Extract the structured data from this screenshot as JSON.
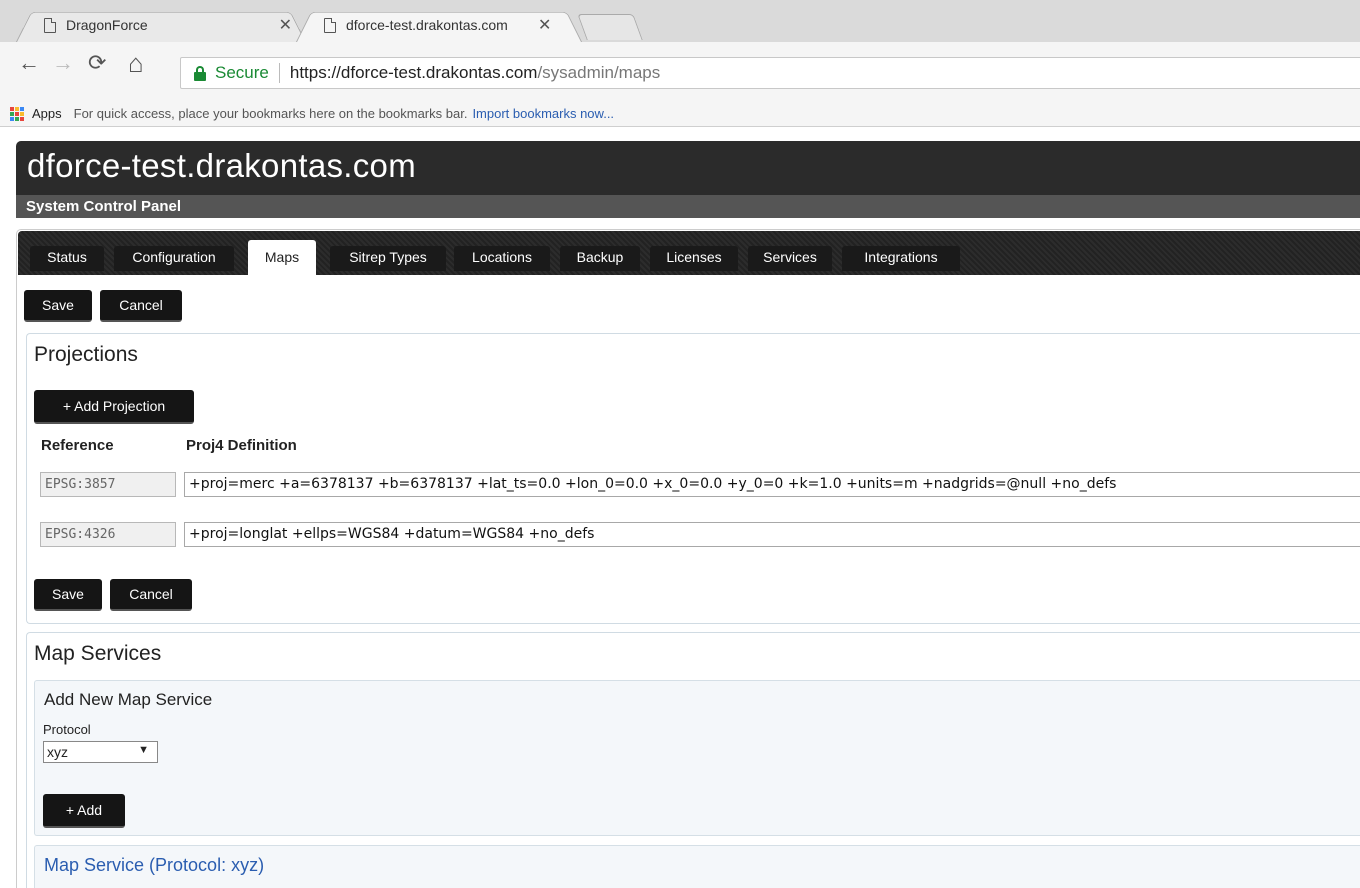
{
  "browser": {
    "tabs": [
      {
        "title": "DragonForce",
        "active": false
      },
      {
        "title": "dforce-test.drakontas.com",
        "active": true
      }
    ],
    "close_glyph": "✕",
    "nav": {
      "back": "←",
      "forward": "→",
      "reload": "⟳",
      "home": "⌂"
    },
    "security_label": "Secure",
    "url_host": "https://dforce-test.drakontas.com",
    "url_path": "/sysadmin/maps",
    "bookmarks": {
      "apps_label": "Apps",
      "hint": "For quick access, place your bookmarks here on the bookmarks bar.",
      "import_link": "Import bookmarks now..."
    },
    "apps_colors": [
      "#e8453c",
      "#f9bb2d",
      "#3a88f4",
      "#34a853",
      "#e8453c",
      "#f9bb2d",
      "#3a88f4",
      "#34a853",
      "#e8453c"
    ]
  },
  "header": {
    "site_title": "dforce-test.drakontas.com",
    "subtitle": "System Control Panel"
  },
  "nav_tabs": [
    "Status",
    "Configuration",
    "Maps",
    "Sitrep Types",
    "Locations",
    "Backup",
    "Licenses",
    "Services",
    "Integrations"
  ],
  "active_tab": "Maps",
  "toolbar": {
    "save_label": "Save",
    "cancel_label": "Cancel"
  },
  "projections": {
    "title": "Projections",
    "add_label": "+ Add Projection",
    "col_reference": "Reference",
    "col_definition": "Proj4 Definition",
    "rows": [
      {
        "reference": "EPSG:3857",
        "definition": "+proj=merc +a=6378137 +b=6378137 +lat_ts=0.0 +lon_0=0.0 +x_0=0.0 +y_0=0 +k=1.0 +units=m +nadgrids=@null +no_defs"
      },
      {
        "reference": "EPSG:4326",
        "definition": "+proj=longlat +ellps=WGS84 +datum=WGS84 +no_defs"
      }
    ],
    "save_label": "Save",
    "cancel_label": "Cancel"
  },
  "map_services": {
    "title": "Map Services",
    "add_new_title": "Add New Map Service",
    "protocol_label": "Protocol",
    "protocol_value": "xyz",
    "add_label": "+ Add",
    "service_title": "Map Service (Protocol: xyz)"
  }
}
